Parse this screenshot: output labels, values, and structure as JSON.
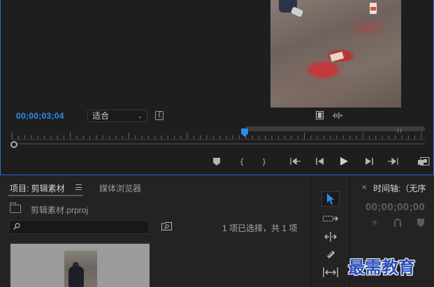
{
  "program_monitor": {
    "timecode": "00;00;03;04",
    "zoom_select": {
      "selected": "适合"
    },
    "transport_icons": [
      "add-marker-icon",
      "mark-in-icon",
      "mark-out-icon",
      "go-to-in-icon",
      "step-back-icon",
      "play-icon",
      "step-forward-icon",
      "go-to-out-icon",
      "export-frame-icon"
    ]
  },
  "project_panel": {
    "tab_label": "项目: 剪辑素材",
    "media_browser_label": "媒体浏览器",
    "project_file": "剪辑素材.prproj",
    "search": {
      "value": "",
      "placeholder": ""
    },
    "selection_status": "1 项已选择，共 1 项"
  },
  "tools_panel": {
    "tools": [
      "selection-tool",
      "track-select-tool",
      "ripple-edit-tool",
      "razor-tool",
      "slip-tool"
    ]
  },
  "timeline_panel": {
    "tab_label": "时间轴:（无序",
    "timecode": "00;00;00;00"
  },
  "watermark": "最需教育",
  "colors": {
    "accent": "#2d8ceb",
    "panel_border": "#2d6fd6"
  }
}
